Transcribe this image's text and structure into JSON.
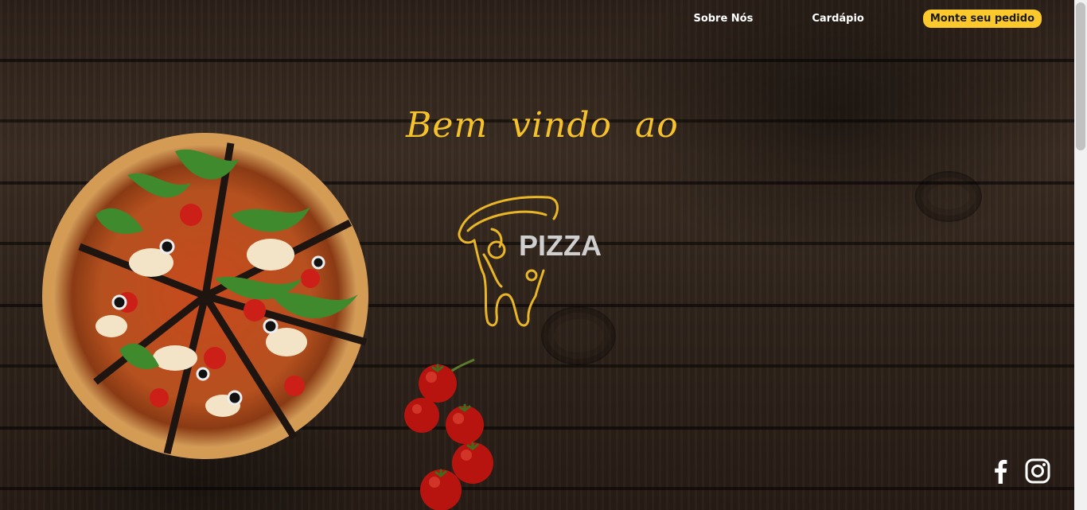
{
  "nav": {
    "about_label": "Sobre Nós",
    "menu_label": "Cardápio",
    "order_label": "Monte seu pedido"
  },
  "hero": {
    "welcome_text": "Bem vindo ao",
    "logo_text": "PIZZA"
  },
  "social": {
    "icons": [
      "facebook-icon",
      "instagram-icon"
    ]
  },
  "colors": {
    "accent": "#fcc92c",
    "heading": "#f5c22b",
    "logo_text": "#cfcfcf",
    "nav_text": "#ffffff",
    "background": "#2b2019"
  }
}
